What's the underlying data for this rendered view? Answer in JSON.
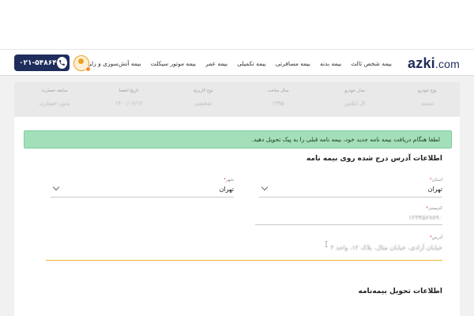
{
  "brand": {
    "logo_main": "azki",
    "logo_tld": ".com"
  },
  "nav": {
    "items": [
      {
        "label": "بیمه شخص ثالث",
        "key": "third-party"
      },
      {
        "label": "بیمه بدنه",
        "key": "body"
      },
      {
        "label": "بیمه مسافرتی",
        "key": "travel"
      },
      {
        "label": "بیمه تکمیلی",
        "key": "supplementary"
      },
      {
        "label": "بیمه عمر",
        "key": "life"
      },
      {
        "label": "بیمه موتور سیکلت",
        "key": "motorcycle"
      },
      {
        "label": "بیمه آتش‌سوزی و زلزله",
        "key": "fire-earthquake"
      }
    ],
    "phone": "۰۲۱-۵۴۸۶۴",
    "phone_icon": "phone-icon",
    "avatar_icon": "user-avatar-icon"
  },
  "summary": {
    "columns": [
      {
        "label": "نوع خودرو",
        "value": "سمند"
      },
      {
        "label": "مدل خودرو",
        "value": "ال ایکس"
      },
      {
        "label": "سال ساخت",
        "value": "۱۳۹۵"
      },
      {
        "label": "نوع کاربری",
        "value": "شخصی"
      },
      {
        "label": "تاریخ انقضا",
        "value": "۱۴۰۰/۰۶/۱۲"
      },
      {
        "label": "سابقه خسارت",
        "value": "بدون خسارت"
      }
    ]
  },
  "alert": {
    "text": "لطفا هنگام دریافت بیمه نامه جدید خود، بیمه نامه قبلی را به پیک تحویل دهید."
  },
  "address_section": {
    "title": "اطلاعات آدرس درج شده روی بیمه نامه",
    "province": {
      "label": "استان",
      "required": "*",
      "value": "تهران"
    },
    "city": {
      "label": "شهر",
      "required": "*",
      "value": "تهران"
    },
    "postal_code": {
      "label": "کدپستی",
      "required": "*",
      "value": "۱۲۳۴۵۶۷۸۹۰"
    },
    "address": {
      "label": "آدرس",
      "required": "*",
      "value": "خیابان آزادی، خیابان مثال، پلاک ۱۲، واحد ۳"
    }
  },
  "delivery_section": {
    "title": "اطلاعات تحویل بیمه‌نامه"
  },
  "colors": {
    "brand_navy": "#1e2d5c",
    "alert_green": "#a3dfb9",
    "accent_yellow": "#f2b52e",
    "required_red": "#e0443a"
  }
}
